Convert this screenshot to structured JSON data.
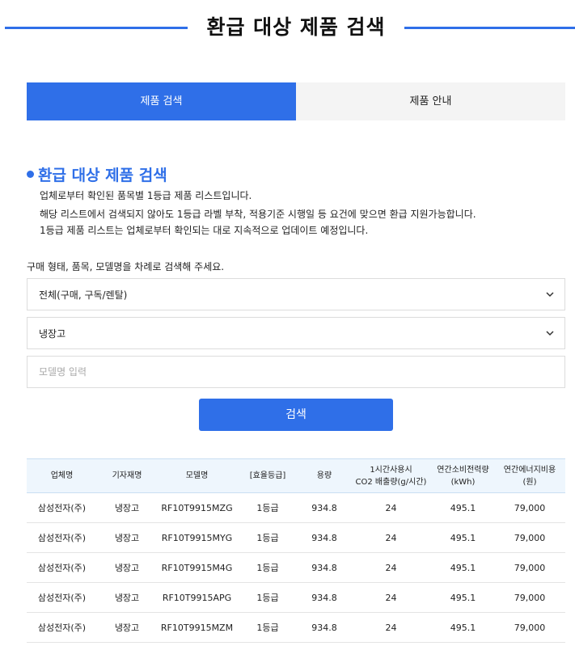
{
  "header": {
    "title": "환급 대상 제품 검색"
  },
  "tabs": [
    {
      "label": "제품 검색",
      "active": true
    },
    {
      "label": "제품 안내",
      "active": false
    }
  ],
  "section": {
    "title": "환급 대상 제품 검색",
    "lines": [
      "업체로부터 확인된 품목별 1등급 제품 리스트입니다.",
      "해당 리스트에서 검색되지 않아도 1등급 라벨 부착, 적용기준 시행일 등 요건에 맞으면 환급 지원가능합니다.",
      "1등급 제품 리스트는 업체로부터 확인되는 대로 지속적으로 업데이트 예정입니다."
    ]
  },
  "search": {
    "instruction": "구매 형태, 품목, 모델명을 차례로 검색해 주세요.",
    "purchase_type": "전체(구매, 구독/렌탈)",
    "category": "냉장고",
    "model_placeholder": "모델명 입력",
    "button_label": "검색"
  },
  "table": {
    "headers": [
      [
        "업체명"
      ],
      [
        "기자재명"
      ],
      [
        "모델명"
      ],
      [
        "[효율등급]"
      ],
      [
        "용량"
      ],
      [
        "1시간사용시",
        "CO2 배출량(g/시간)"
      ],
      [
        "연간소비전력량",
        "(kWh)"
      ],
      [
        "연간에너지비용",
        "(원)"
      ]
    ],
    "rows": [
      [
        "삼성전자(주)",
        "냉장고",
        "RF10T9915MZG",
        "1등급",
        "934.8",
        "24",
        "495.1",
        "79,000"
      ],
      [
        "삼성전자(주)",
        "냉장고",
        "RF10T9915MYG",
        "1등급",
        "934.8",
        "24",
        "495.1",
        "79,000"
      ],
      [
        "삼성전자(주)",
        "냉장고",
        "RF10T9915M4G",
        "1등급",
        "934.8",
        "24",
        "495.1",
        "79,000"
      ],
      [
        "삼성전자(주)",
        "냉장고",
        "RF10T9915APG",
        "1등급",
        "934.8",
        "24",
        "495.1",
        "79,000"
      ],
      [
        "삼성전자(주)",
        "냉장고",
        "RF10T9915MZM",
        "1등급",
        "934.8",
        "24",
        "495.1",
        "79,000"
      ]
    ]
  },
  "colors": {
    "accent": "#2f6fe8",
    "table_header_bg": "#eef6fd",
    "tab_inactive_bg": "#f4f4f4"
  }
}
